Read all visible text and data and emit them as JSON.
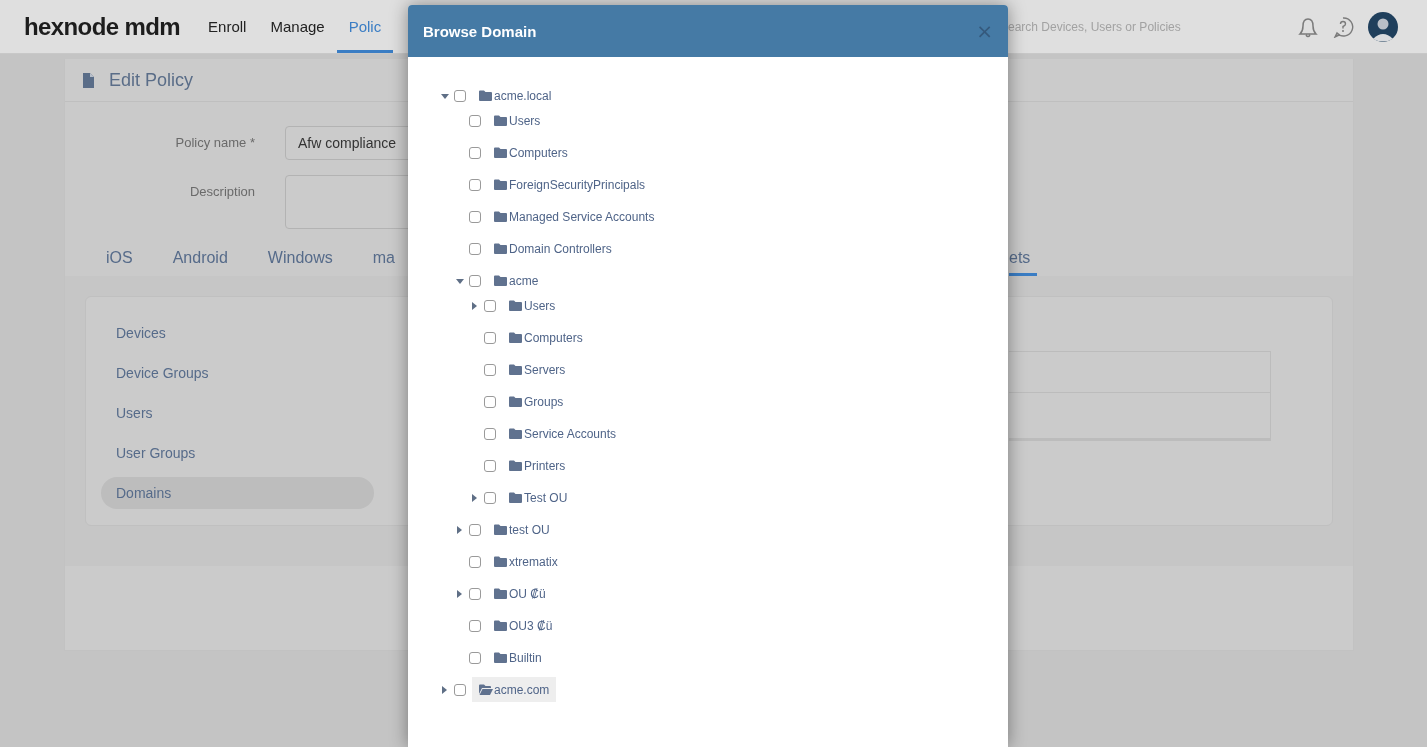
{
  "nav": {
    "logo": "hexnode mdm",
    "items": [
      {
        "label": "Enroll",
        "selected": false
      },
      {
        "label": "Manage",
        "selected": false
      },
      {
        "label": "Polic",
        "selected": true
      }
    ],
    "search": {
      "placeholder": "earch Devices, Users or Policies"
    }
  },
  "page": {
    "title": "Edit Policy",
    "fields": [
      {
        "kind": "input",
        "label": "Policy name *",
        "value": "Afw compliance"
      },
      {
        "kind": "textarea",
        "label": "Description"
      }
    ],
    "platform_tabs": [
      {
        "label": "iOS",
        "selected": false
      },
      {
        "label": "Android",
        "selected": false
      },
      {
        "label": "Windows",
        "selected": false
      },
      {
        "label": "ma",
        "selected": false
      },
      {
        "label": "ets",
        "selected": true
      }
    ],
    "target_types": [
      {
        "label": "Devices",
        "selected": false
      },
      {
        "label": "Device Groups",
        "selected": false
      },
      {
        "label": "Users",
        "selected": false
      },
      {
        "label": "User Groups",
        "selected": false
      },
      {
        "label": "Domains",
        "selected": true
      }
    ]
  },
  "dialog": {
    "title": "Browse Domain",
    "close": "×",
    "tree": [
      {
        "label": "acme.local",
        "checked": false,
        "has_children": true,
        "expanded": true,
        "selected": false,
        "children": [
          {
            "label": "Users",
            "checked": false,
            "has_children": false,
            "expanded": false,
            "selected": false
          },
          {
            "label": "Computers",
            "checked": false,
            "has_children": false,
            "expanded": false,
            "selected": false
          },
          {
            "label": "ForeignSecurityPrincipals",
            "checked": false,
            "has_children": false,
            "expanded": false,
            "selected": false
          },
          {
            "label": "Managed Service Accounts",
            "checked": false,
            "has_children": false,
            "expanded": false,
            "selected": false
          },
          {
            "label": "Domain Controllers",
            "checked": false,
            "has_children": false,
            "expanded": false,
            "selected": false
          },
          {
            "label": "acme",
            "checked": false,
            "has_children": true,
            "expanded": true,
            "selected": false,
            "children": [
              {
                "label": "Users",
                "checked": false,
                "has_children": true,
                "expanded": false,
                "selected": false
              },
              {
                "label": "Computers",
                "checked": false,
                "has_children": false,
                "expanded": false,
                "selected": false
              },
              {
                "label": "Servers",
                "checked": false,
                "has_children": false,
                "expanded": false,
                "selected": false
              },
              {
                "label": "Groups",
                "checked": false,
                "has_children": false,
                "expanded": false,
                "selected": false
              },
              {
                "label": "Service Accounts",
                "checked": false,
                "has_children": false,
                "expanded": false,
                "selected": false
              },
              {
                "label": "Printers",
                "checked": false,
                "has_children": false,
                "expanded": false,
                "selected": false
              },
              {
                "label": "Test OU",
                "checked": false,
                "has_children": true,
                "expanded": false,
                "selected": false
              }
            ]
          },
          {
            "label": "test OU",
            "checked": false,
            "has_children": true,
            "expanded": false,
            "selected": false
          },
          {
            "label": "xtrematix",
            "checked": false,
            "has_children": false,
            "expanded": false,
            "selected": false
          },
          {
            "label": "OU ₡ü",
            "checked": false,
            "has_children": true,
            "expanded": false,
            "selected": false
          },
          {
            "label": "OU3 ₡ü",
            "checked": false,
            "has_children": false,
            "expanded": false,
            "selected": false
          },
          {
            "label": "Builtin",
            "checked": false,
            "has_children": false,
            "expanded": false,
            "selected": false
          }
        ]
      },
      {
        "label": "acme.com",
        "checked": false,
        "has_children": true,
        "expanded": false,
        "selected": true
      }
    ]
  }
}
